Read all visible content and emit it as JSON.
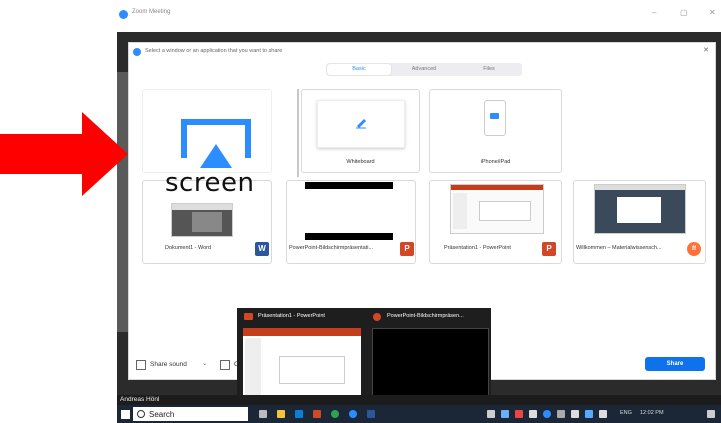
{
  "zoom_window": {
    "title": "Zoom Meeting",
    "minimize": "–",
    "maximize": "▢",
    "close": "✕"
  },
  "dialog": {
    "title": "Select a window or an application that you want to share",
    "close": "✕",
    "tabs": [
      {
        "label": "Basic"
      },
      {
        "label": "Advanced"
      },
      {
        "label": "Files"
      }
    ],
    "tiles": [
      {
        "label": "Whiteboard"
      },
      {
        "label": "iPhone/iPad"
      }
    ],
    "windows": [
      {
        "label": "Dokument1 - Word",
        "app": "W",
        "color": "#2b579a"
      },
      {
        "label": "PowerPoint-Bildschirmpräsentati...",
        "app": "P",
        "color": "#d24726"
      },
      {
        "label": "Präsentation1 - PowerPoint",
        "app": "P",
        "color": "#d24726"
      },
      {
        "label": "Willkommen – Materialwissensch...",
        "app": "ff",
        "color": "#ff7139"
      }
    ],
    "share_sound": "Share sound",
    "share_sound_caret": "⌄",
    "optimize_partial": "O",
    "share_button": "Share"
  },
  "overlay": {
    "screen_text": "screen",
    "arrow_color": "#ff0000"
  },
  "preview": {
    "left_title": "Präsentation1 - PowerPoint",
    "right_title": "PowerPoint-Bildschirmpräsen..."
  },
  "participant": "Andreas Hönl",
  "taskbar": {
    "search_placeholder": "Search",
    "tray_lang": "ENG",
    "tray_time": "12:02 PM"
  }
}
